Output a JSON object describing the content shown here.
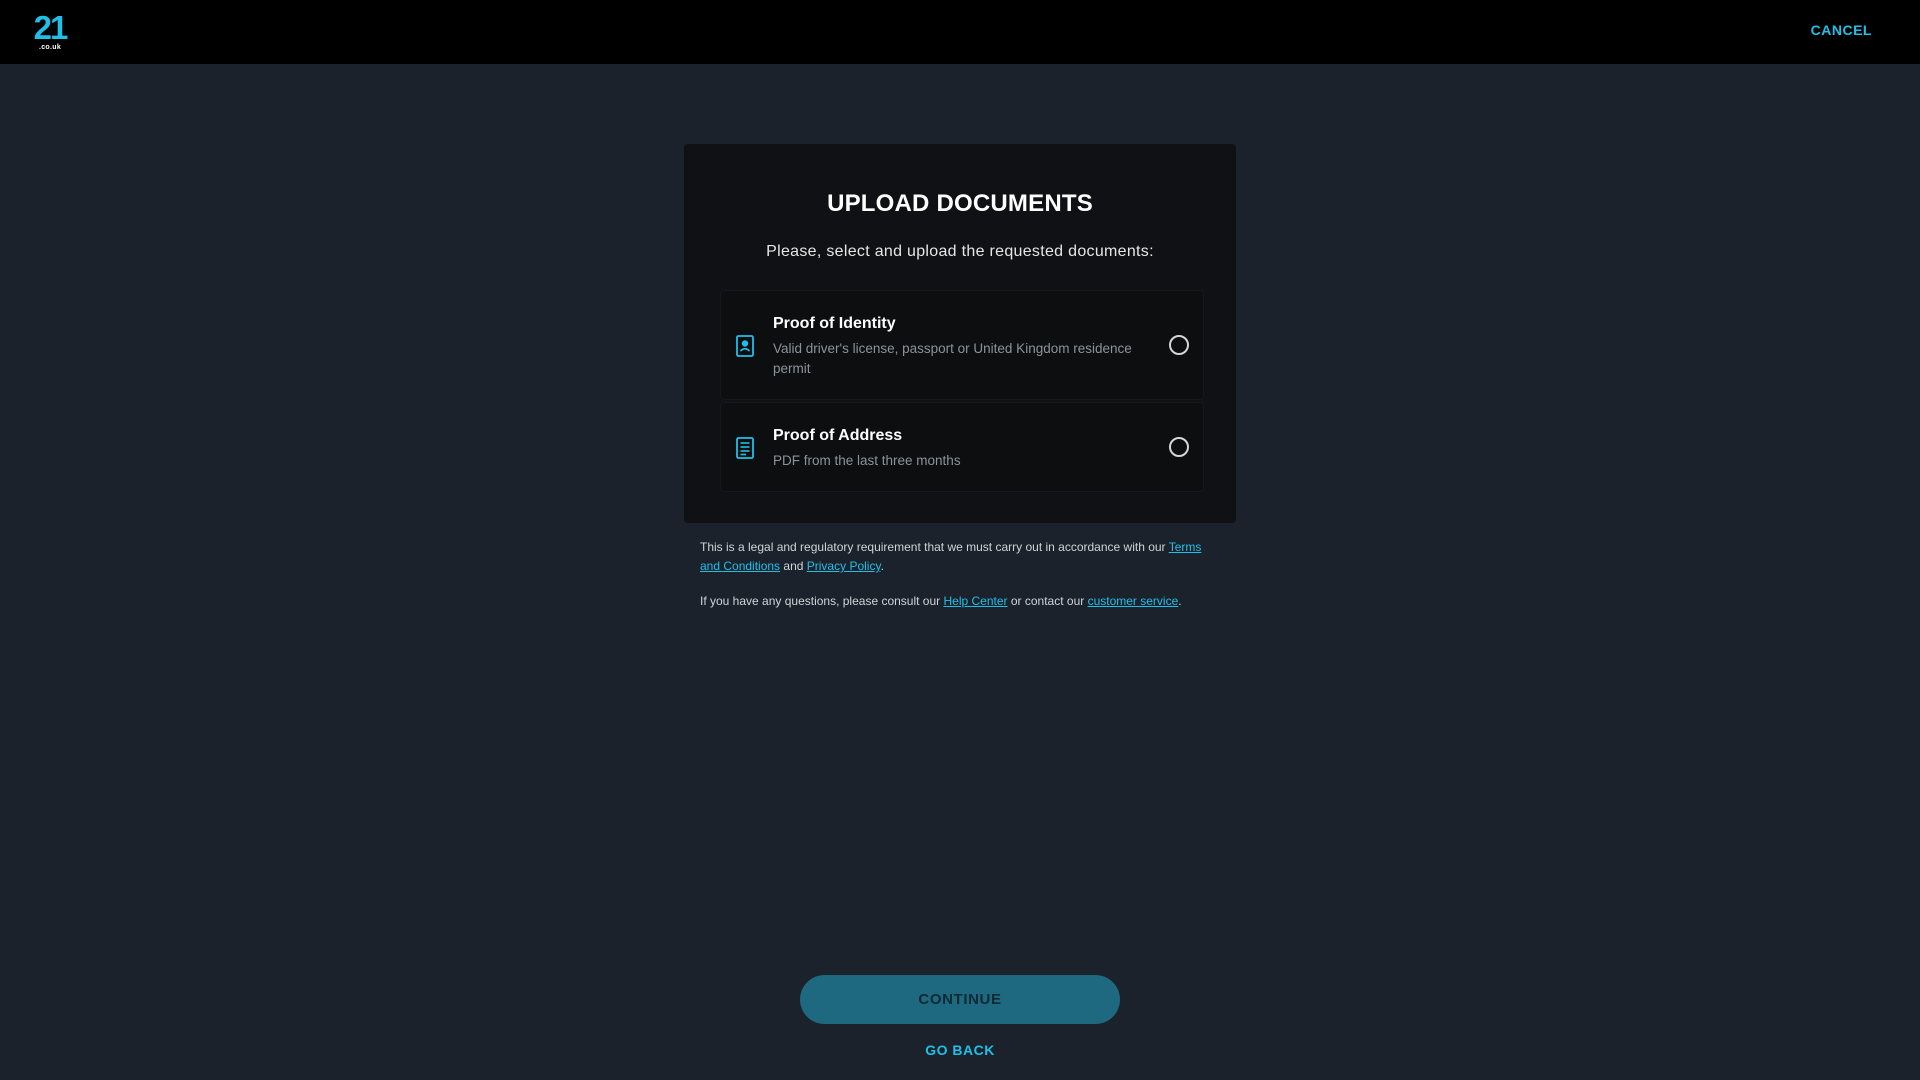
{
  "header": {
    "logo_number": "21",
    "logo_tld": ".co.uk",
    "cancel_label": "CANCEL"
  },
  "card": {
    "title": "UPLOAD DOCUMENTS",
    "subtitle": "Please, select and upload the requested documents:",
    "options": [
      {
        "title": "Proof of Identity",
        "description": "Valid driver's license, passport or United Kingdom residence permit",
        "icon": "id-document-icon",
        "selected": false
      },
      {
        "title": "Proof of Address",
        "description": "PDF from the last three months",
        "icon": "document-lines-icon",
        "selected": false
      }
    ]
  },
  "legal": {
    "p1_text": "This is a legal and regulatory requirement that we must carry out in accordance with our ",
    "terms_link": "Terms and Conditions",
    "p1_and": " and ",
    "privacy_link": "Privacy Policy",
    "p1_end": ".",
    "p2_text": "If you have any questions, please consult our ",
    "help_link": "Help Center",
    "p2_mid": " or contact our ",
    "service_link": "customer service",
    "p2_end": "."
  },
  "footer": {
    "continue_label": "CONTINUE",
    "goback_label": "GO BACK"
  },
  "colors": {
    "accent": "#1ec0e8",
    "background": "#1b222c",
    "card": "#0f1114",
    "continue_button": "#1e6880"
  }
}
